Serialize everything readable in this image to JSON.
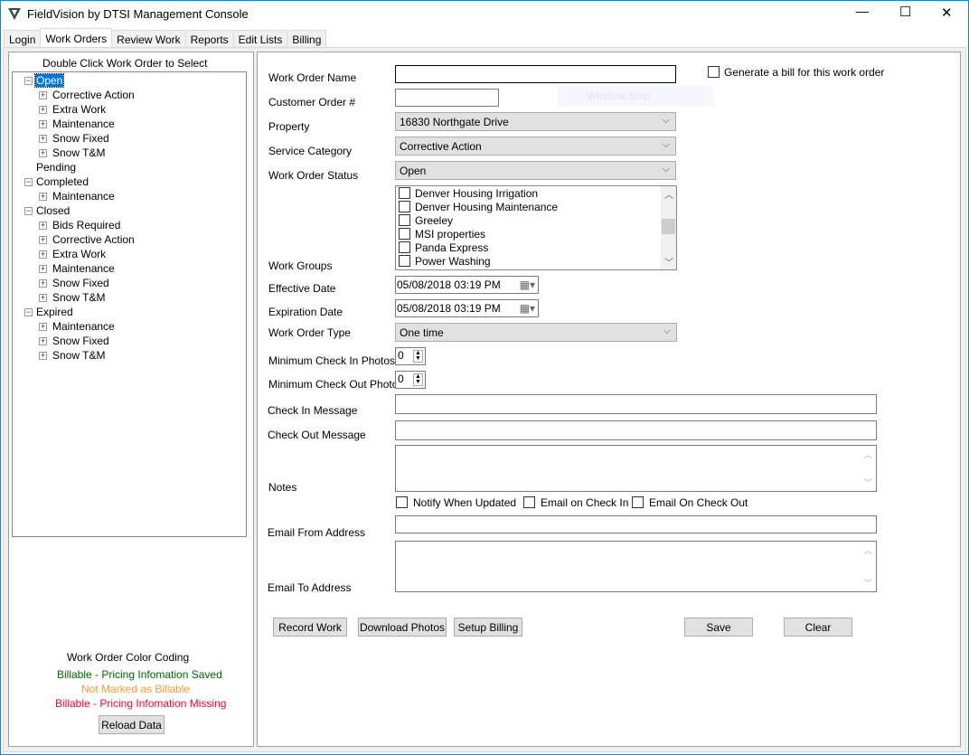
{
  "window": {
    "title": "FieldVision by DTSI Management Console",
    "minimize": "—",
    "maximize": "☐",
    "close": "✕"
  },
  "tabs": [
    "Login",
    "Work Orders",
    "Review Work",
    "Reports",
    "Edit Lists",
    "Billing"
  ],
  "active_tab": "Work Orders",
  "left": {
    "heading": "Double Click Work Order to Select",
    "tree": [
      {
        "label": "Open",
        "level": 0,
        "expanded": true,
        "selected": true
      },
      {
        "label": "Corrective Action",
        "level": 1
      },
      {
        "label": "Extra Work",
        "level": 1
      },
      {
        "label": "Maintenance",
        "level": 1
      },
      {
        "label": "Snow Fixed",
        "level": 1
      },
      {
        "label": "Snow T&M",
        "level": 1
      },
      {
        "label": "Pending",
        "level": 0,
        "leaf": true
      },
      {
        "label": "Completed",
        "level": 0,
        "expanded": true
      },
      {
        "label": "Maintenance",
        "level": 1
      },
      {
        "label": "Closed",
        "level": 0,
        "expanded": true
      },
      {
        "label": "Bids Required",
        "level": 1
      },
      {
        "label": "Corrective Action",
        "level": 1
      },
      {
        "label": "Extra Work",
        "level": 1
      },
      {
        "label": "Maintenance",
        "level": 1
      },
      {
        "label": "Snow Fixed",
        "level": 1
      },
      {
        "label": "Snow T&M",
        "level": 1
      },
      {
        "label": "Expired",
        "level": 0,
        "expanded": true
      },
      {
        "label": "Maintenance",
        "level": 1
      },
      {
        "label": "Snow Fixed",
        "level": 1
      },
      {
        "label": "Snow T&M",
        "level": 1
      }
    ],
    "legend_title": "Work Order Color Coding",
    "legend": [
      {
        "text": "Billable - Pricing Infomation Saved",
        "color": "#006400"
      },
      {
        "text": "Not Marked as Billable",
        "color": "#ff9933"
      },
      {
        "text": "Billable - Pricing Infomation Missing",
        "color": "#ff0033"
      }
    ],
    "reload": "Reload Data"
  },
  "form": {
    "work_order_name": {
      "label": "Work Order Name",
      "value": ""
    },
    "generate_bill": {
      "label": "Generate a bill for this work order",
      "checked": false
    },
    "customer_order": {
      "label": "Customer Order #",
      "value": ""
    },
    "overlay": "Window Snip",
    "property": {
      "label": "Property",
      "value": "16830 Northgate Drive"
    },
    "service_category": {
      "label": "Service Category",
      "value": "Corrective Action"
    },
    "status": {
      "label": "Work Order Status",
      "value": "Open"
    },
    "work_groups": {
      "label": "Work Groups",
      "items": [
        "Denver Housing Irrigation",
        "Denver Housing Maintenance",
        "Greeley",
        "MSI properties",
        "Panda Express",
        "Power Washing"
      ]
    },
    "effective_date": {
      "label": "Effective Date",
      "value": "05/08/2018 03:19 PM"
    },
    "expiration_date": {
      "label": "Expiration Date",
      "value": "05/08/2018 03:19 PM"
    },
    "type": {
      "label": "Work Order Type",
      "value": "One time"
    },
    "min_in": {
      "label": "Minimum Check In Photos",
      "value": "0"
    },
    "min_out": {
      "label": "Minimum Check Out Photos",
      "value": "0"
    },
    "checkin_msg": {
      "label": "Check In Message",
      "value": ""
    },
    "checkout_msg": {
      "label": "Check Out Message",
      "value": ""
    },
    "notes": {
      "label": "Notes",
      "value": ""
    },
    "notify": {
      "label": "Notify When Updated",
      "checked": false
    },
    "email_in": {
      "label": "Email on Check In",
      "checked": false
    },
    "email_out": {
      "label": "Email On Check Out",
      "checked": false
    },
    "email_from": {
      "label": "Email From Address",
      "value": ""
    },
    "email_to": {
      "label": "Email To Address",
      "value": ""
    }
  },
  "buttons": {
    "record": "Record Work",
    "download": "Download Photos",
    "billing": "Setup Billing",
    "save": "Save",
    "clear": "Clear"
  }
}
